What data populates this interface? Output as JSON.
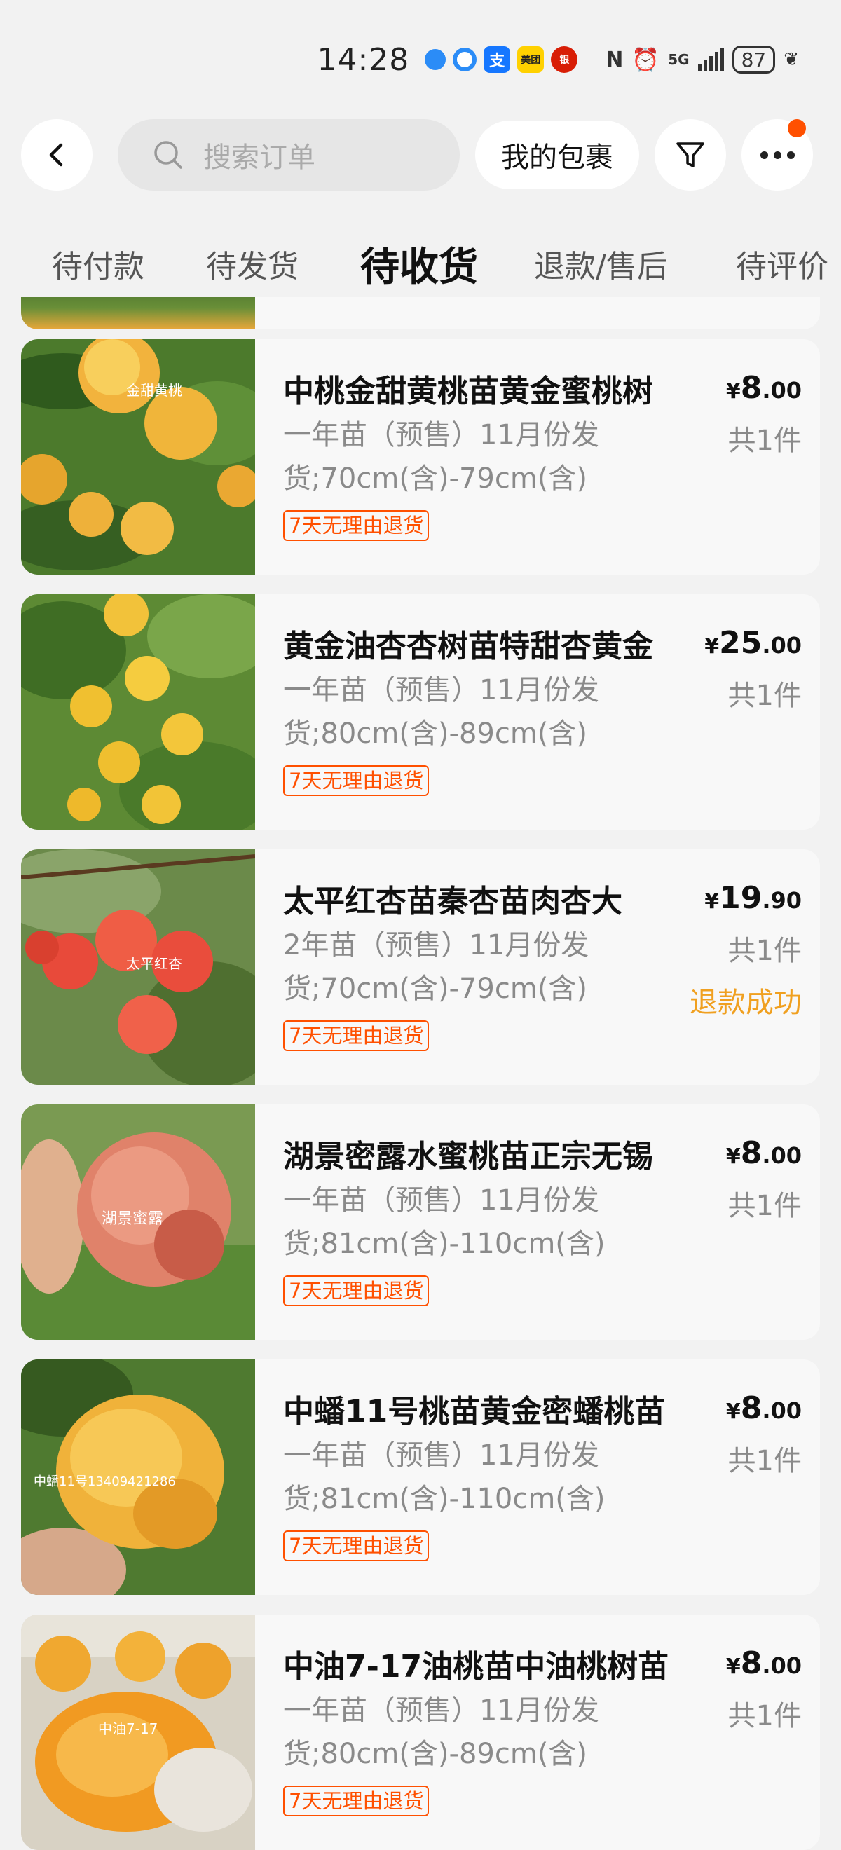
{
  "status_bar": {
    "time": "14:28",
    "app_icons": [
      "message-icon",
      "qq-browser-icon",
      "alipay-icon",
      "meituan-icon",
      "bank-icon"
    ],
    "alipay_glyph": "支",
    "meituan_text": "美团",
    "bank_text": "银",
    "network": "5G",
    "battery": "87"
  },
  "header": {
    "search_placeholder": "搜索订单",
    "parcel_label": "我的包裹",
    "notification_dot_color": "#ff5000"
  },
  "tabs": [
    {
      "label": "待付款",
      "active": false
    },
    {
      "label": "待发货",
      "active": false
    },
    {
      "label": "待收货",
      "active": true
    },
    {
      "label": "退款/售后",
      "active": false
    },
    {
      "label": "待评价",
      "active": false
    }
  ],
  "orders": [
    {
      "title": "中桃金甜黄桃苗黄金蜜桃树",
      "spec": "一年苗（预售）11月份发货;70cm(含)-79cm(含)",
      "tag": "7天无理由退货",
      "price_symbol": "¥",
      "price_int": "8",
      "price_dec": ".00",
      "qty": "共1件",
      "status": "",
      "image_text": "金甜黄桃"
    },
    {
      "title": "黄金油杏杏树苗特甜杏黄金",
      "spec": "一年苗（预售）11月份发货;80cm(含)-89cm(含)",
      "tag": "7天无理由退货",
      "price_symbol": "¥",
      "price_int": "25",
      "price_dec": ".00",
      "qty": "共1件",
      "status": "",
      "image_text": ""
    },
    {
      "title": "太平红杏苗秦杏苗肉杏大",
      "spec": "2年苗（预售）11月份发货;70cm(含)-79cm(含)",
      "tag": "7天无理由退货",
      "price_symbol": "¥",
      "price_int": "19",
      "price_dec": ".90",
      "qty": "共1件",
      "status": "退款成功",
      "image_text": "太平红杏"
    },
    {
      "title": "湖景密露水蜜桃苗正宗无锡",
      "spec": "一年苗（预售）11月份发货;81cm(含)-110cm(含)",
      "tag": "7天无理由退货",
      "price_symbol": "¥",
      "price_int": "8",
      "price_dec": ".00",
      "qty": "共1件",
      "status": "",
      "image_text": "湖景蜜露"
    },
    {
      "title": "中蟠11号桃苗黄金密蟠桃苗",
      "spec": "一年苗（预售）11月份发货;81cm(含)-110cm(含)",
      "tag": "7天无理由退货",
      "price_symbol": "¥",
      "price_int": "8",
      "price_dec": ".00",
      "qty": "共1件",
      "status": "",
      "image_text": "中蟠11号13409421286"
    },
    {
      "title": "中油7-17油桃苗中油桃树苗",
      "spec": "一年苗（预售）11月份发货;80cm(含)-89cm(含)",
      "tag": "7天无理由退货",
      "price_symbol": "¥",
      "price_int": "8",
      "price_dec": ".00",
      "qty": "共1件",
      "status": "",
      "image_text": "中油7-17"
    }
  ],
  "colors": {
    "accent": "#ff5000",
    "refund_status": "#f0a020",
    "muted_text": "#8a8a8a",
    "card_bg": "#f8f8f8",
    "page_bg": "#f2f2f2"
  }
}
